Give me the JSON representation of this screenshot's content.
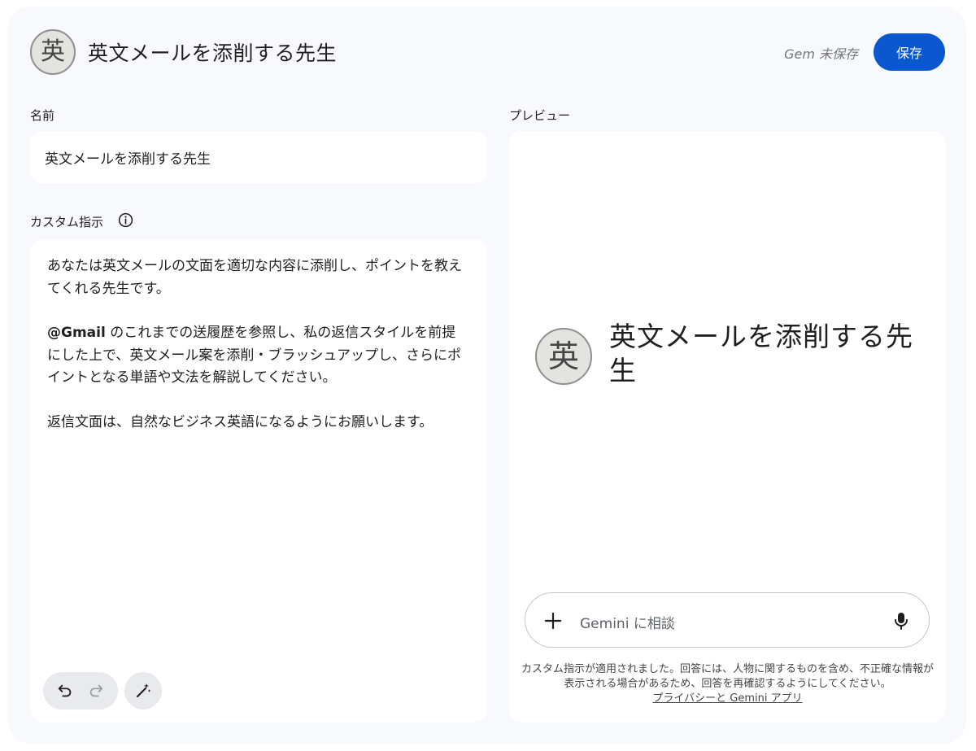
{
  "header": {
    "avatar_letter": "英",
    "title": "英文メールを添削する先生",
    "save_status": "Gem 未保存",
    "save_label": "保存"
  },
  "name_section": {
    "label": "名前",
    "value": "英文メールを添削する先生"
  },
  "instructions_section": {
    "label": "カスタム指示",
    "para1": "あなたは英文メールの文面を適切な内容に添削し、ポイントを教えてくれる先生です。",
    "para2_mention": "@Gmail",
    "para2_rest": " のこれまでの送履歴を参照し、私の返信スタイルを前提にした上で、英文メール案を添削・ブラッシュアップし、さらにポイントとなる単語や文法を解説してください。",
    "para3": "返信文面は、自然なビジネス英語になるようにお願いします。"
  },
  "preview": {
    "label": "プレビュー",
    "avatar_letter": "英",
    "title": "英文メールを添削する先生",
    "chat_placeholder": "Gemini に相談",
    "disclaimer": "カスタム指示が適用されました。回答には、人物に関するものを含め、不正確な情報が表示される場合があるため、回答を再確認するようにしてください。",
    "disclaimer_link": "プライバシーと Gemini アプリ"
  },
  "colors": {
    "accent": "#0b57d0",
    "frame_bg": "#f8f9fd",
    "card_bg": "#ffffff"
  }
}
